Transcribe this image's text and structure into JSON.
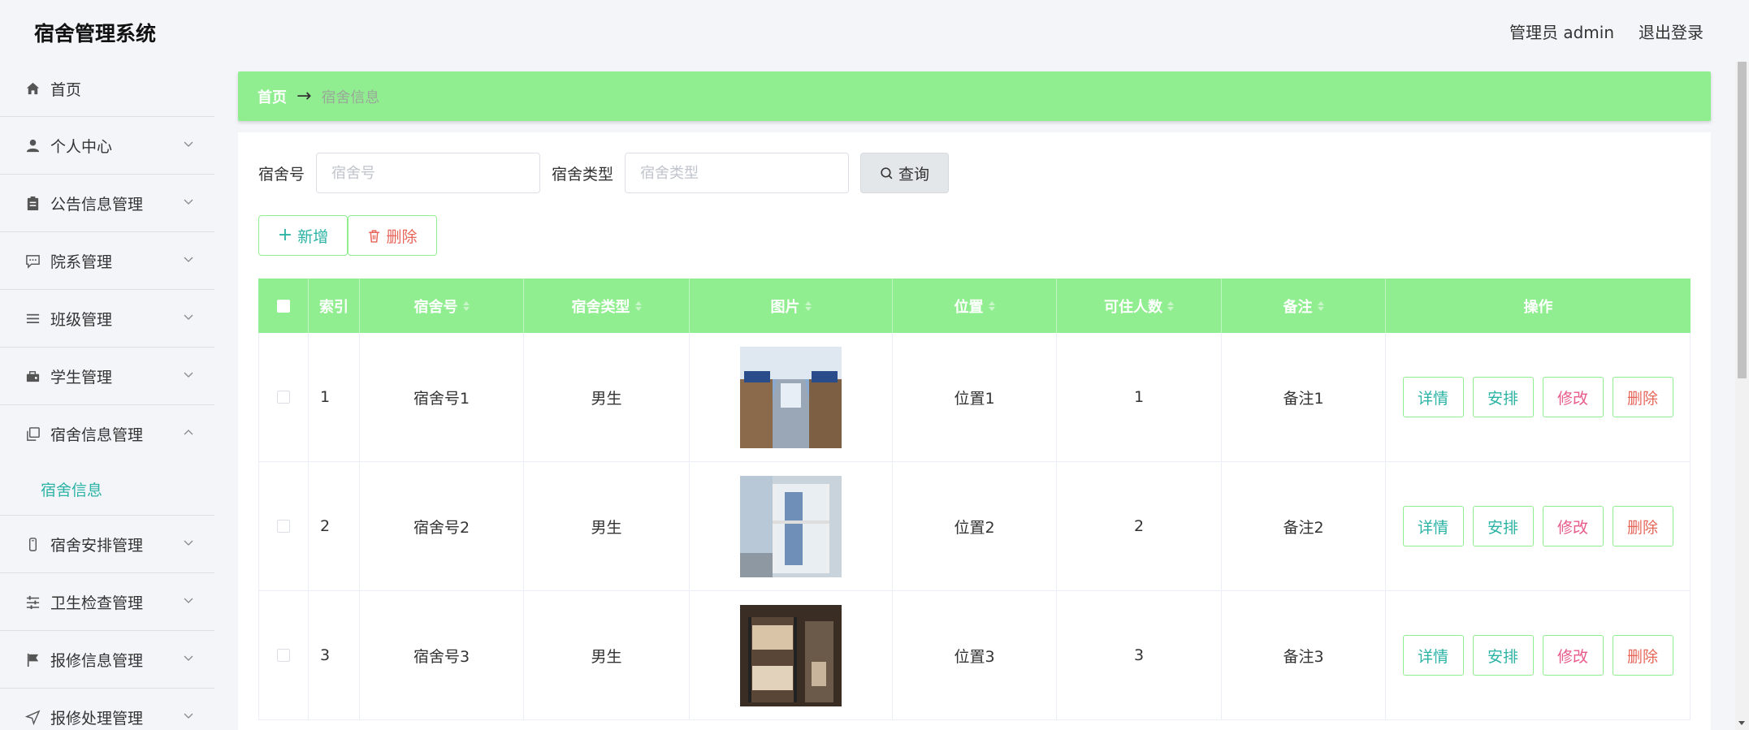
{
  "header": {
    "title": "宿舍管理系统",
    "user": "管理员 admin",
    "logout": "退出登录"
  },
  "sidebar": {
    "items": [
      {
        "label": "首页",
        "icon": "home-icon"
      },
      {
        "label": "个人中心",
        "icon": "user-icon"
      },
      {
        "label": "公告信息管理",
        "icon": "clipboard-icon"
      },
      {
        "label": "院系管理",
        "icon": "chat-icon"
      },
      {
        "label": "班级管理",
        "icon": "list-icon"
      },
      {
        "label": "学生管理",
        "icon": "briefcase-icon"
      },
      {
        "label": "宿舍信息管理",
        "icon": "copy-icon"
      },
      {
        "label": "宿舍安排管理",
        "icon": "phone-icon"
      },
      {
        "label": "卫生检查管理",
        "icon": "sliders-icon"
      },
      {
        "label": "报修信息管理",
        "icon": "flag-icon"
      },
      {
        "label": "报修处理管理",
        "icon": "send-icon"
      }
    ],
    "subitem": "宿舍信息"
  },
  "breadcrumb": {
    "home": "首页",
    "sep": "→",
    "current": "宿舍信息"
  },
  "search": {
    "room_label": "宿舍号",
    "room_placeholder": "宿舍号",
    "type_label": "宿舍类型",
    "type_placeholder": "宿舍类型",
    "query_button": "查询"
  },
  "actions": {
    "add": "新增",
    "delete": "删除"
  },
  "table": {
    "headers": [
      "索引",
      "宿舍号",
      "宿舍类型",
      "图片",
      "位置",
      "可住人数",
      "备注",
      "操作"
    ],
    "rows": [
      {
        "index": "1",
        "room": "宿舍号1",
        "type": "男生",
        "location": "位置1",
        "capacity": "1",
        "remark": "备注1"
      },
      {
        "index": "2",
        "room": "宿舍号2",
        "type": "男生",
        "location": "位置2",
        "capacity": "2",
        "remark": "备注2"
      },
      {
        "index": "3",
        "room": "宿舍号3",
        "type": "男生",
        "location": "位置3",
        "capacity": "3",
        "remark": "备注3"
      }
    ],
    "ops": {
      "detail": "详情",
      "arrange": "安排",
      "edit": "修改",
      "delete": "删除"
    }
  },
  "colors": {
    "accent": "#90ee90",
    "link": "#2bb3a5",
    "danger": "#e7665a"
  }
}
